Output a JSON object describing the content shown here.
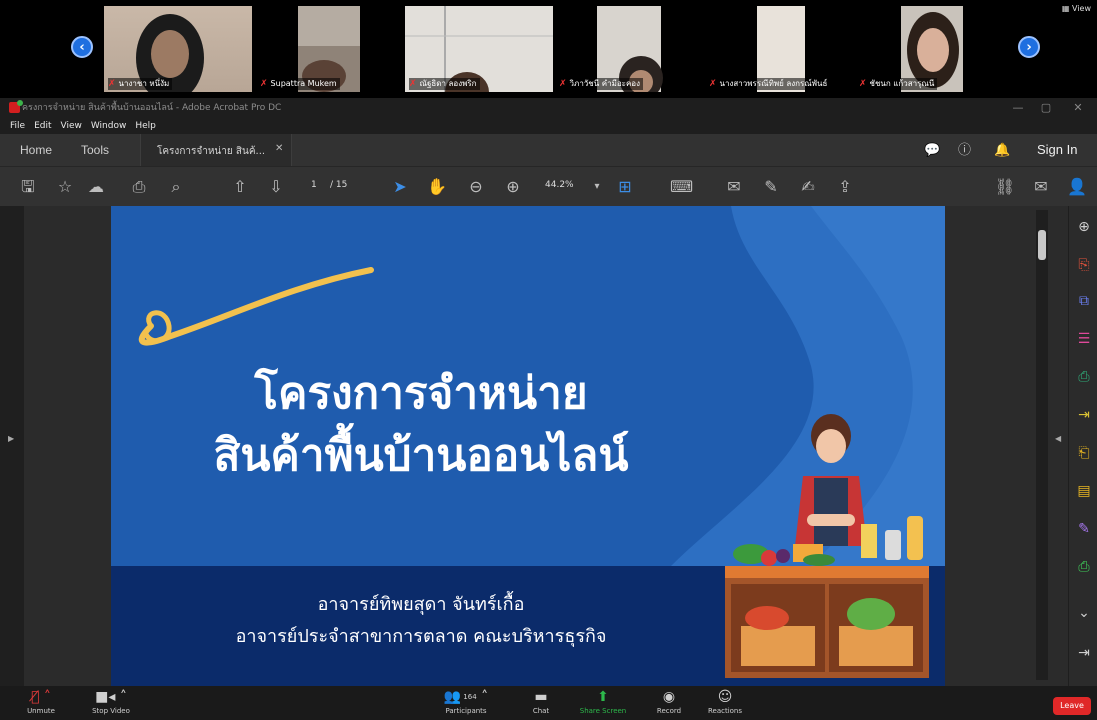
{
  "gallery": {
    "participants": [
      {
        "name": "นางาชา หนึ่งัม"
      },
      {
        "name": "Supattra Mukem"
      },
      {
        "name": "ณัฐธิดา ลองพริก"
      },
      {
        "name": "วิภาวัชนี คำมีอะคอง"
      },
      {
        "name": "นางสาวพรรณีทิพย์ ลงกรณ์พันธ์"
      },
      {
        "name": "ชัชนก แก้วสารุณนี"
      }
    ],
    "view_label": "View"
  },
  "acrobat": {
    "window_title": "ครงการจำหน่าย สินค้าพื้นบ้านออนไลน์ - Adobe Acrobat Pro DC",
    "menu": [
      "File",
      "Edit",
      "View",
      "Window",
      "Help"
    ],
    "tabs": {
      "home": "Home",
      "tools": "Tools",
      "document": "โครงการจำหน่าย สินค้..."
    },
    "sign_in": "Sign In",
    "page_current": "1",
    "page_total": "/ 15",
    "zoom": "44.2%"
  },
  "slide": {
    "title_line1": "โครงการจำหน่าย",
    "title_line2": "สินค้าพื้นบ้านออนไลน์",
    "author": "อาจารย์ทิพยสุดา  จันทร์เกื้อ",
    "department": "อาจารย์ประจำสาขาการตลาด คณะบริหารธุรกิจ"
  },
  "zoom_bar": {
    "unmute": "Unmute",
    "stop_video": "Stop Video",
    "participants": "Participants",
    "participants_count": "164",
    "chat": "Chat",
    "share_screen": "Share Screen",
    "record": "Record",
    "reactions": "Reactions",
    "leave": "Leave"
  },
  "colors": {
    "slide_blue": "#1f5cae",
    "slide_navy": "#0b2b6a",
    "zoom_nav_blue": "#1f6fe0",
    "leave_red": "#e02828",
    "share_green": "#2db84b"
  }
}
